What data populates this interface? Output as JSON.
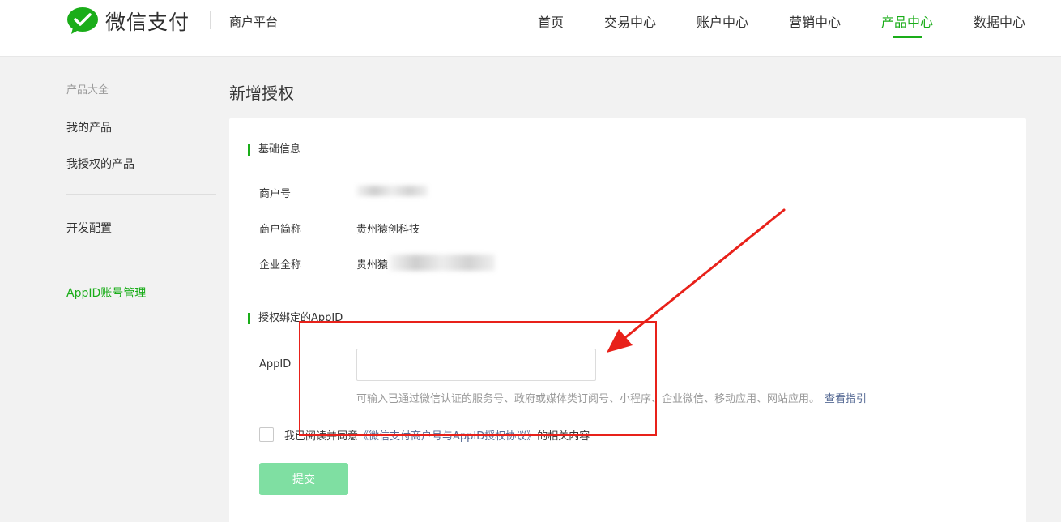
{
  "header": {
    "brand": "微信支付",
    "platform": "商户平台",
    "nav": [
      "首页",
      "交易中心",
      "账户中心",
      "营销中心",
      "产品中心",
      "数据中心"
    ],
    "active_nav": "产品中心"
  },
  "sidebar": {
    "title": "产品大全",
    "items": [
      {
        "label": "我的产品"
      },
      {
        "label": "我授权的产品"
      },
      {
        "label": "开发配置"
      },
      {
        "label": "AppID账号管理"
      }
    ],
    "active_item": "AppID账号管理"
  },
  "page": {
    "title": "新增授权"
  },
  "basic": {
    "heading": "基础信息",
    "merchant_id_label": "商户号",
    "short_name_label": "商户简称",
    "short_name_value": "贵州猿创科技",
    "full_name_label": "企业全称",
    "full_name_value": "贵州猿"
  },
  "bind": {
    "heading": "授权绑定的AppID",
    "appid_label": "AppID",
    "appid_value": "",
    "hint": "可输入已通过微信认证的服务号、政府或媒体类订阅号、小程序、企业微信、移动应用、网站应用。",
    "guide_link": "查看指引"
  },
  "agreement": {
    "prefix": "我已阅读并同意",
    "link": "《微信支付商户号与AppID授权协议》",
    "suffix": "的相关内容",
    "checked": false
  },
  "submit_label": "提交",
  "colors": {
    "brand_green": "#1aad19",
    "link_blue": "#576b95",
    "submit_disabled": "#7fdfa2",
    "annotation_red": "#e8211a"
  }
}
